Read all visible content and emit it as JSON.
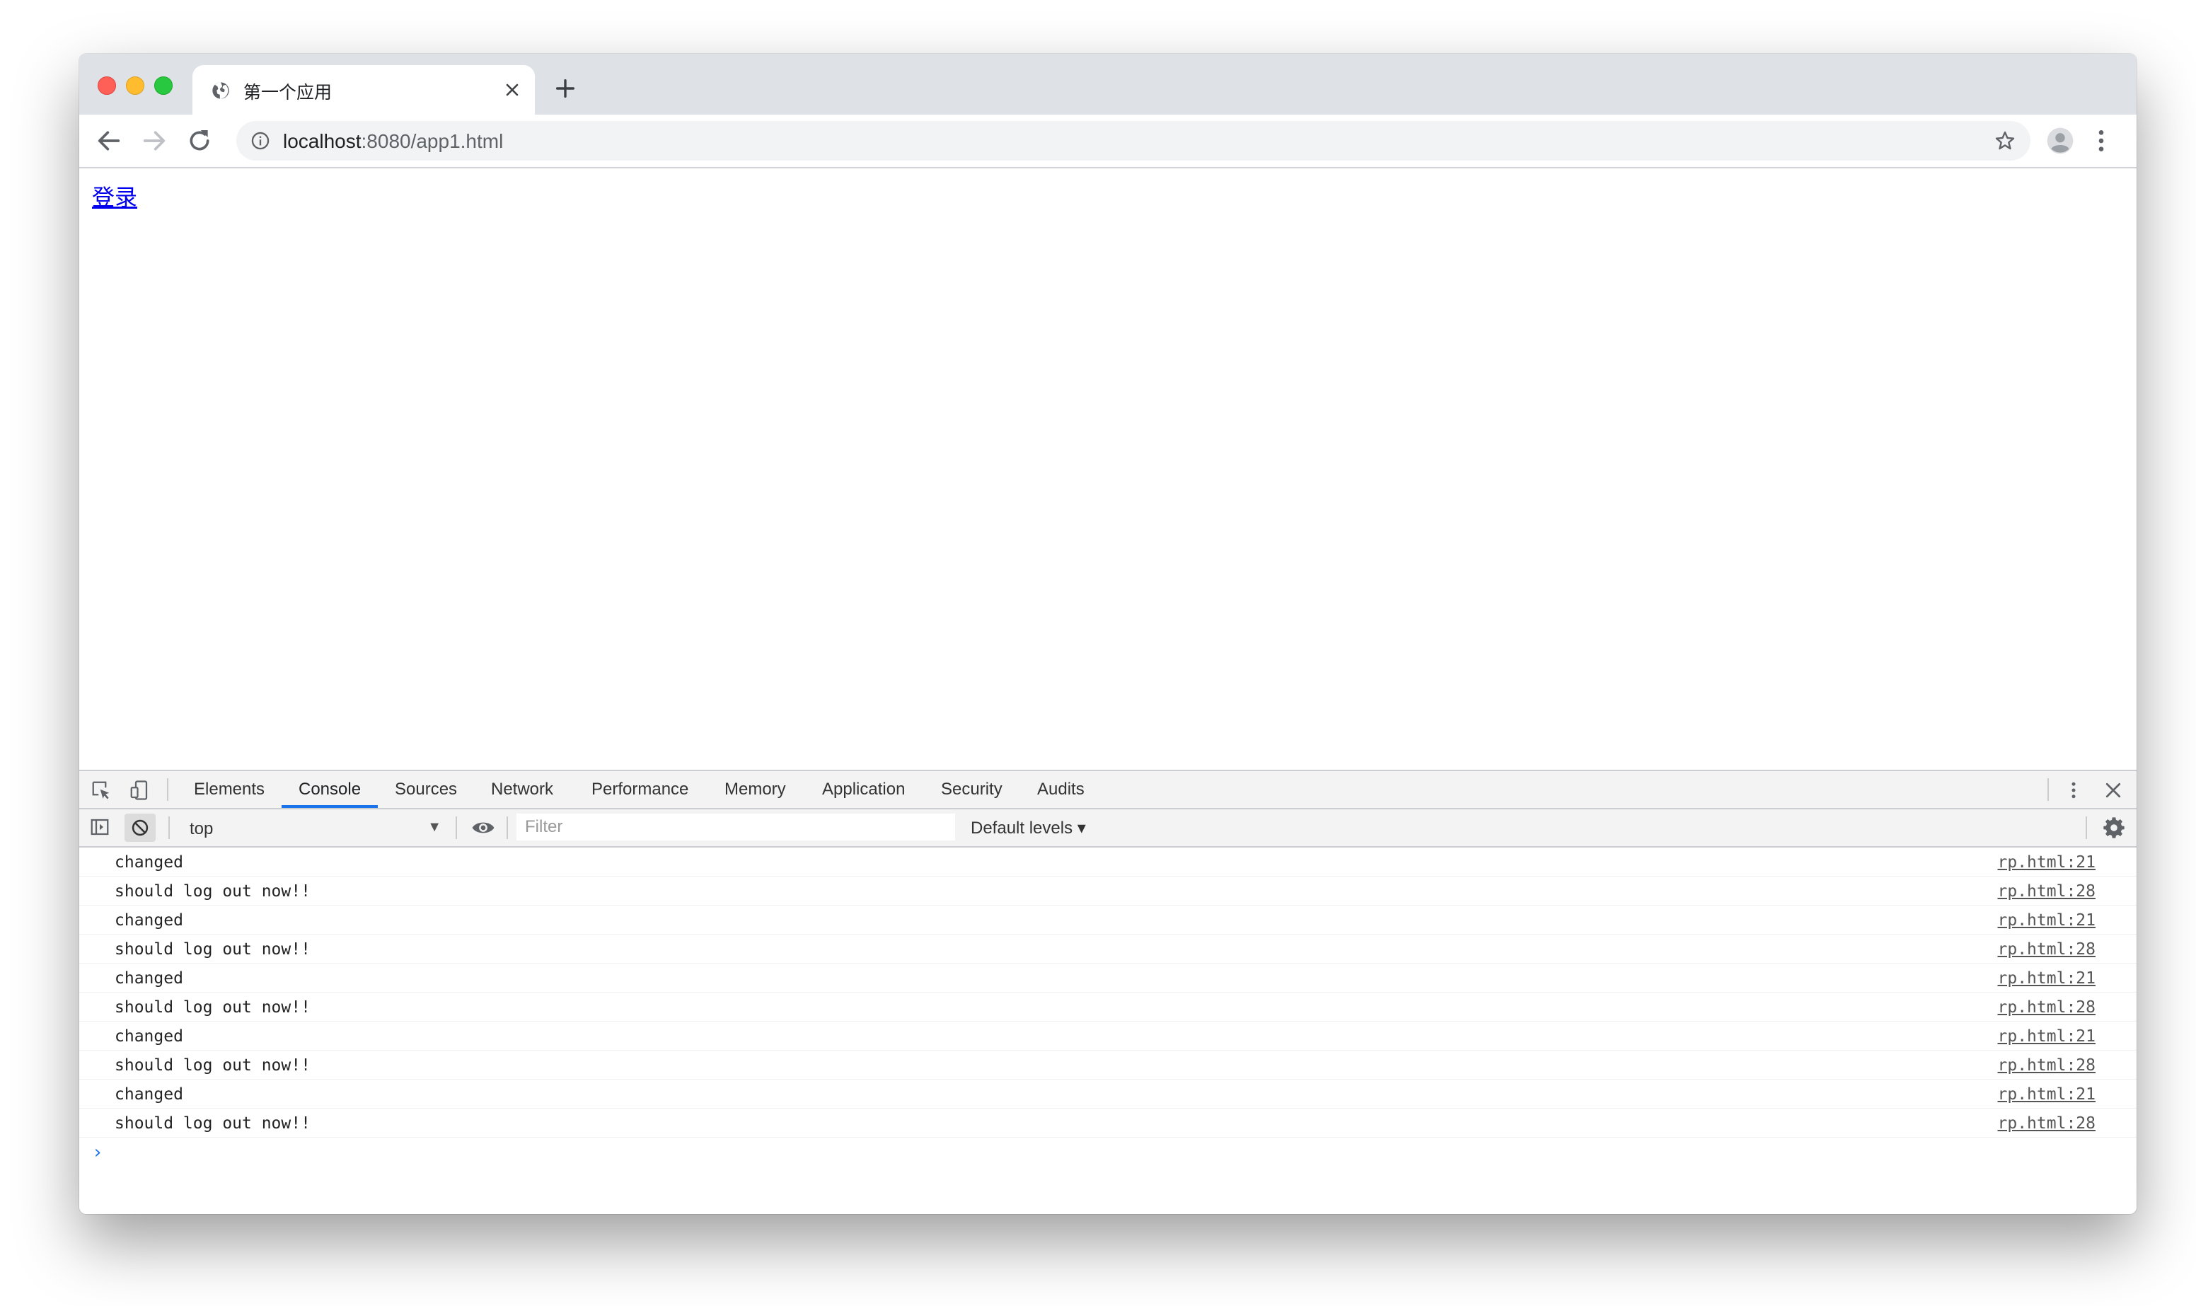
{
  "browser": {
    "tab": {
      "title": "第一个应用",
      "favicon": "globe-icon"
    },
    "url": {
      "host": "localhost",
      "rest": ":8080/app1.html"
    }
  },
  "page": {
    "link_text": "登录"
  },
  "devtools": {
    "tabs": [
      {
        "label": "Elements",
        "active": false
      },
      {
        "label": "Console",
        "active": true
      },
      {
        "label": "Sources",
        "active": false
      },
      {
        "label": "Network",
        "active": false
      },
      {
        "label": "Performance",
        "active": false
      },
      {
        "label": "Memory",
        "active": false
      },
      {
        "label": "Application",
        "active": false
      },
      {
        "label": "Security",
        "active": false
      },
      {
        "label": "Audits",
        "active": false
      }
    ],
    "console_toolbar": {
      "context": "top",
      "filter_placeholder": "Filter",
      "levels": "Default levels ▾"
    },
    "logs": [
      {
        "message": "changed",
        "source": "rp.html:21"
      },
      {
        "message": "should log out now!!",
        "source": "rp.html:28"
      },
      {
        "message": "changed",
        "source": "rp.html:21"
      },
      {
        "message": "should log out now!!",
        "source": "rp.html:28"
      },
      {
        "message": "changed",
        "source": "rp.html:21"
      },
      {
        "message": "should log out now!!",
        "source": "rp.html:28"
      },
      {
        "message": "changed",
        "source": "rp.html:21"
      },
      {
        "message": "should log out now!!",
        "source": "rp.html:28"
      },
      {
        "message": "changed",
        "source": "rp.html:21"
      },
      {
        "message": "should log out now!!",
        "source": "rp.html:28"
      }
    ],
    "prompt_symbol": "›"
  },
  "colors": {
    "accent": "#1a73e8",
    "link": "#0000ee",
    "tab_strip": "#dee1e6"
  }
}
